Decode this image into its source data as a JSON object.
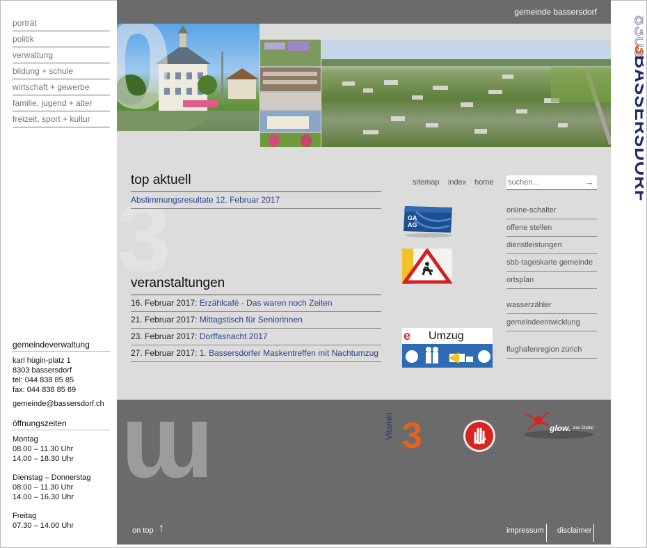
{
  "site_name": "gemeinde bassersdorf",
  "logo": {
    "number": "8303",
    "text": "BASSERSDORF"
  },
  "nav": [
    "porträt",
    "politik",
    "verwaltung",
    "bildung + schule",
    "wirtschaft + gewerbe",
    "familie, jugend + alter",
    "freizeit, sport + kultur"
  ],
  "contact": {
    "heading": "gemeindeverwaltung",
    "street": "karl hügin-platz 1",
    "city": "8303 bassersdorf",
    "tel": "tel: 044 838 85 85",
    "fax": "fax: 044 838 85 69",
    "email": "gemeinde@bassersdorf.ch"
  },
  "hours": {
    "heading": "öffnungszeiten",
    "blocks": [
      {
        "day": "Montag",
        "l1": "08.00 – 11.30 Uhr",
        "l2": "14.00 – 18.30 Uhr"
      },
      {
        "day": "Dienstag – Donnerstag",
        "l1": "08.00 – 11.30 Uhr",
        "l2": "14.00 – 16.30 Uhr"
      },
      {
        "day": "Freitag",
        "l1": "07.30 – 14.00 Uhr",
        "l2": ""
      }
    ]
  },
  "top_aktuell": {
    "title": "top aktuell",
    "items": [
      "Abstimmungsresultate 12. Februar 2017"
    ]
  },
  "veranstaltungen": {
    "title": "veranstaltungen",
    "items": [
      {
        "date": "16. Februar 2017:",
        "text": "Erzählcafé - Das waren noch Zeiten"
      },
      {
        "date": "21. Februar 2017:",
        "text": "Mittagstisch für Seniorinnen"
      },
      {
        "date": "23. Februar 2017:",
        "text": "Dorffasnacht 2017"
      },
      {
        "date": "27. Februar 2017:",
        "text": "1. Bassersdorfer Maskentreffen mit Nachtumzug"
      }
    ]
  },
  "util_links": {
    "sitemap": "sitemap",
    "index": "index",
    "home": "home"
  },
  "search": {
    "placeholder": "suchen..."
  },
  "quick_links_1": [
    "online-schalter",
    "offene stellen",
    "dienstleistungen",
    "sbb-tageskarte gemeinde",
    "ortsplan"
  ],
  "quick_links_2": [
    "wasserzähler",
    "gemeindeentwicklung"
  ],
  "quick_links_3": [
    "flughafenregion zürich"
  ],
  "banners": {
    "gaag_label": "GA AG",
    "umzug_label": "Umzug",
    "vitamin_label": "Vitamin",
    "vitamin_num": "3",
    "glow_label": "glow.",
    "glow_sub": "das Glattal"
  },
  "footer": {
    "ontop": "on top",
    "impressum": "impressum",
    "disclaimer": "disclaimer"
  }
}
